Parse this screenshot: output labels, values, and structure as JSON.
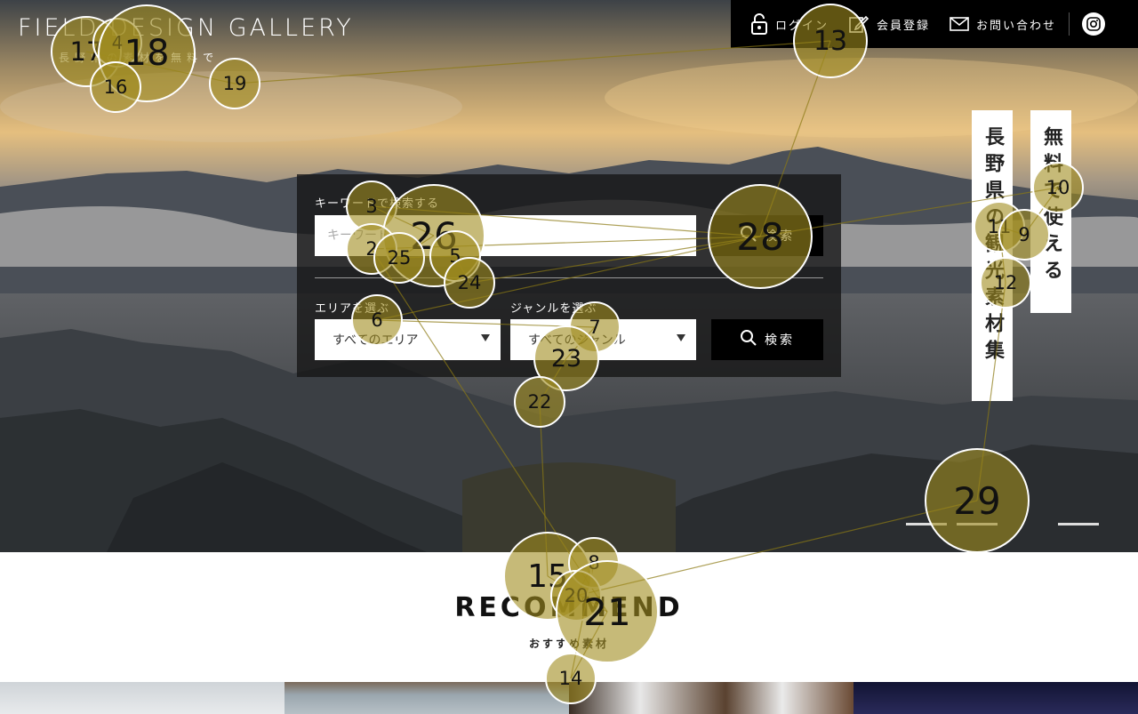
{
  "brand": {
    "logo": "FIELD DESIGN GALLERY",
    "tagline": "長野県の素材を無料で"
  },
  "topbar": {
    "login": "ログイン",
    "register": "会員登録",
    "contact": "お問い合わせ",
    "icons": [
      "lock-icon",
      "pencil-icon",
      "mail-icon",
      "instagram-icon"
    ]
  },
  "hero": {
    "vertical_title_1": "長野県の観光素材集",
    "vertical_title_2": "無料で使える",
    "slides_total": 3
  },
  "search": {
    "keyword_label": "キーワードで検索する",
    "keyword_placeholder": "キーワード",
    "search_button": "検索",
    "area_label": "エリアを選ぶ",
    "area_value": "すべてのエリア",
    "genre_label": "ジャンルを選ぶ",
    "genre_value": "すべてのジャンル",
    "filter_button": "検索"
  },
  "recommend": {
    "title": "RECOMMEND",
    "subtitle": "おすすめ素材"
  },
  "overlay": {
    "color": "#8c7a14",
    "bubbles": [
      {
        "n": "17"
      },
      {
        "n": "4"
      },
      {
        "n": "18"
      },
      {
        "n": "16"
      },
      {
        "n": "19"
      },
      {
        "n": "13"
      },
      {
        "n": "10"
      },
      {
        "n": "11"
      },
      {
        "n": "9"
      },
      {
        "n": "12"
      },
      {
        "n": "3"
      },
      {
        "n": "26"
      },
      {
        "n": "2"
      },
      {
        "n": "25"
      },
      {
        "n": "5"
      },
      {
        "n": "24"
      },
      {
        "n": "28"
      },
      {
        "n": "6"
      },
      {
        "n": "7"
      },
      {
        "n": "23"
      },
      {
        "n": "22"
      },
      {
        "n": "29"
      },
      {
        "n": "15"
      },
      {
        "n": "8"
      },
      {
        "n": "20"
      },
      {
        "n": "21"
      },
      {
        "n": "14"
      }
    ]
  }
}
